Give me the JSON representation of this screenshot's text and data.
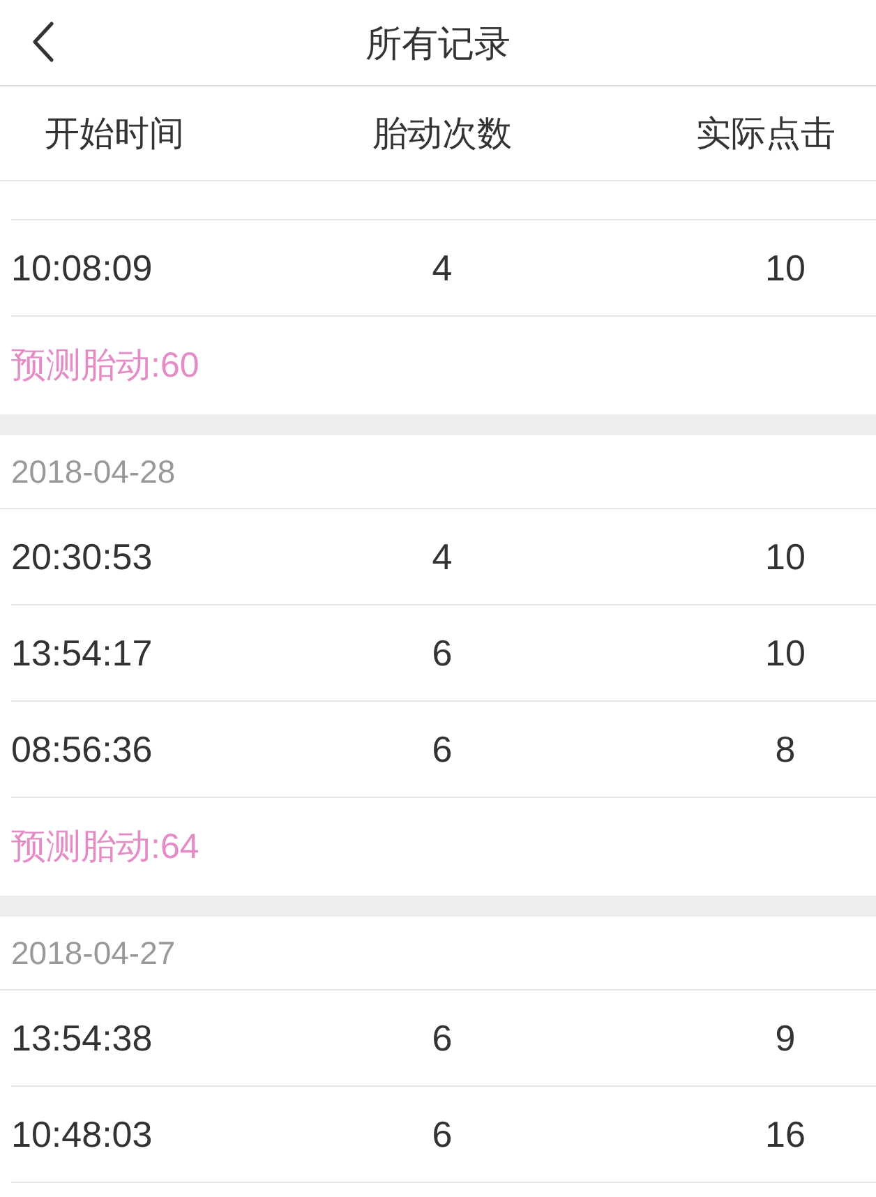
{
  "nav": {
    "title": "所有记录"
  },
  "columns": [
    "开始时间",
    "胎动次数",
    "实际点击"
  ],
  "groups": [
    {
      "records": [
        {
          "start_time": "10:08:09",
          "kicks": "4",
          "clicks": "10"
        }
      ],
      "prediction": "预测胎动:60"
    },
    {
      "date": "2018-04-28",
      "records": [
        {
          "start_time": "20:30:53",
          "kicks": "4",
          "clicks": "10"
        },
        {
          "start_time": "13:54:17",
          "kicks": "6",
          "clicks": "10"
        },
        {
          "start_time": "08:56:36",
          "kicks": "6",
          "clicks": "8"
        }
      ],
      "prediction": "预测胎动:64"
    },
    {
      "date": "2018-04-27",
      "records": [
        {
          "start_time": "13:54:38",
          "kicks": "6",
          "clicks": "9"
        },
        {
          "start_time": "10:48:03",
          "kicks": "6",
          "clicks": "16"
        }
      ]
    }
  ]
}
